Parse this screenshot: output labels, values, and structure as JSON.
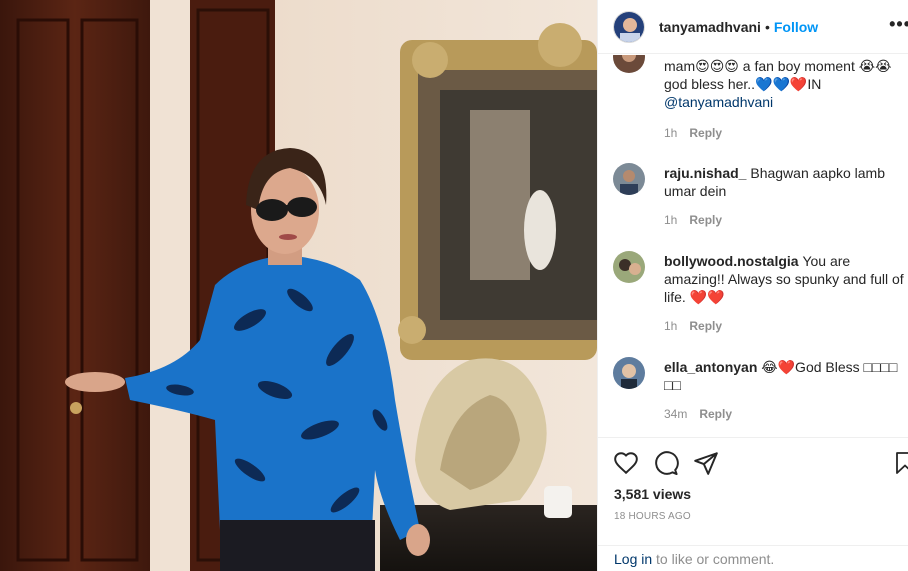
{
  "header": {
    "username": "tanyamadhvani",
    "separator": "•",
    "follow_label": "Follow",
    "more_label": "•••"
  },
  "comments": [
    {
      "text_a": "mam😍😍😍 a fan boy moment 😭😭",
      "text_b": "god bless her..💙💙❤️IN",
      "mention": "@tanyamadhvani",
      "time": "1h",
      "reply": "Reply"
    },
    {
      "username": "raju.nishad_",
      "text": "Bhagwan aapko lamb umar dein",
      "time": "1h",
      "reply": "Reply"
    },
    {
      "username": "bollywood.nostalgia",
      "text": "You are amazing!! Always so spunky and full of life. ❤️❤️",
      "time": "1h",
      "reply": "Reply"
    },
    {
      "username": "ella_antonyan",
      "text": "😂❤️God Bless □□□□ □□",
      "time": "34m",
      "reply": "Reply"
    }
  ],
  "actions": {
    "views": "3,581 views",
    "posted": "18 HOURS AGO"
  },
  "login": {
    "link": "Log in",
    "rest": " to like or comment."
  },
  "icons": [
    "heart-icon",
    "comment-icon",
    "share-icon",
    "bookmark-icon"
  ],
  "colors": {
    "accent": "#0095f6",
    "link": "#00376b",
    "muted": "#8e8e8e",
    "shirt": "#1a73c9"
  }
}
